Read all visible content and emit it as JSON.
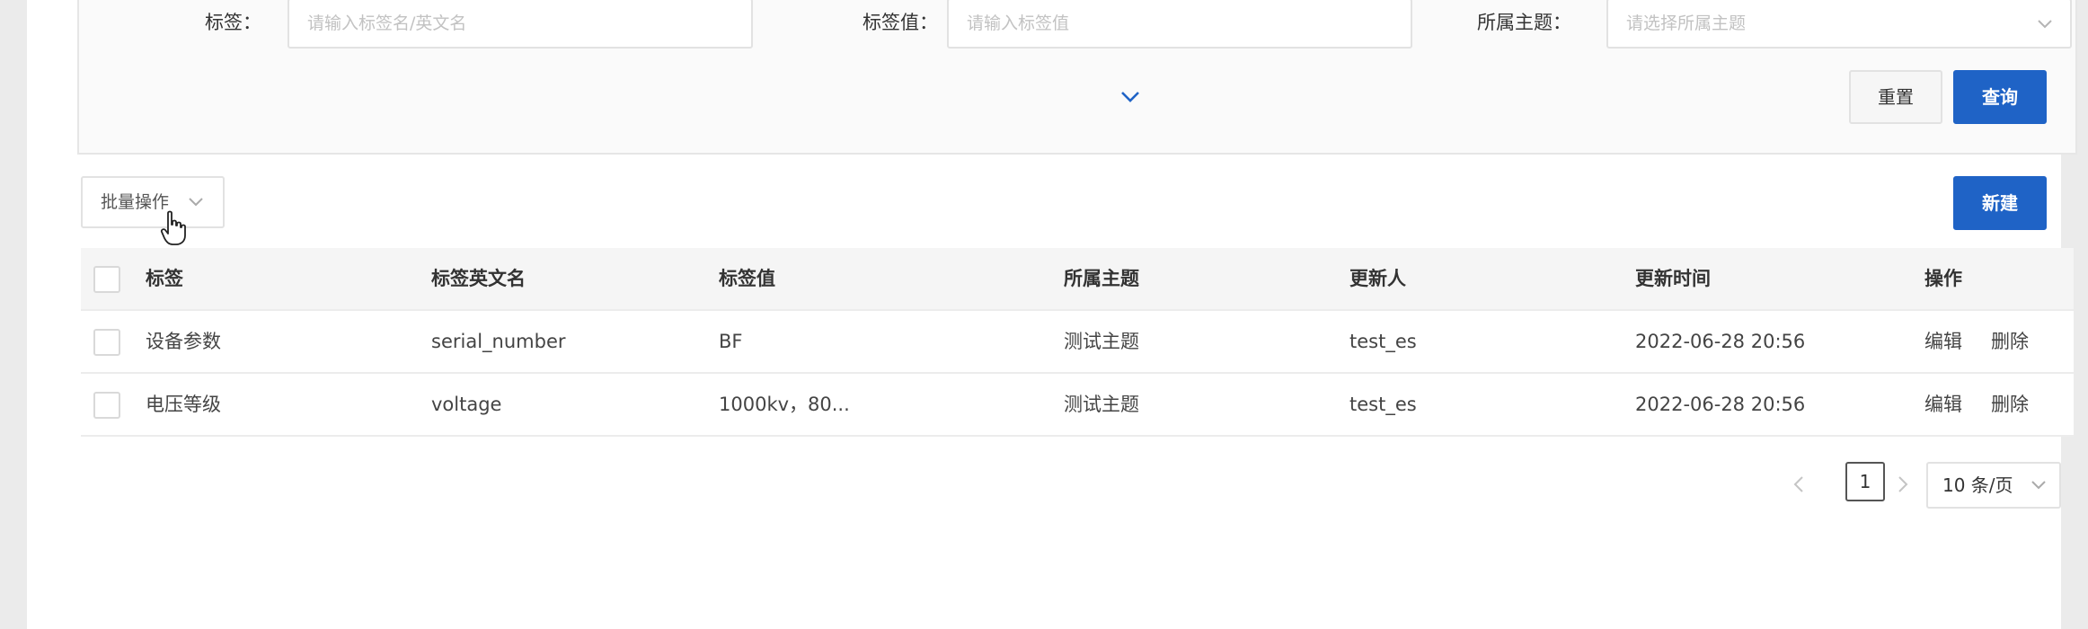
{
  "filters": {
    "tag_label": "标签：",
    "tag_placeholder": "请输入标签名/英文名",
    "tag_value_label": "标签值：",
    "tag_value_placeholder": "请输入标签值",
    "topic_label": "所属主题：",
    "topic_placeholder": "请选择所属主题",
    "expand_icon": "chevron-down-icon",
    "reset_label": "重置",
    "query_label": "查询"
  },
  "toolbar": {
    "batch_label": "批量操作",
    "new_label": "新建"
  },
  "table": {
    "columns": [
      "标签",
      "标签英文名",
      "标签值",
      "所属主题",
      "更新人",
      "更新时间",
      "操作"
    ],
    "rows": [
      {
        "tag": "设备参数",
        "english_name": "serial_number",
        "value": "BF",
        "topic": "测试主题",
        "updater": "test_es",
        "updated_at": "2022-06-28 20:56",
        "edit": "编辑",
        "delete": "删除"
      },
      {
        "tag": "电压等级",
        "english_name": "voltage",
        "value": "1000kv，80...",
        "topic": "测试主题",
        "updater": "test_es",
        "updated_at": "2022-06-28 20:56",
        "edit": "编辑",
        "delete": "删除"
      }
    ]
  },
  "pagination": {
    "current_page": "1",
    "page_size": "10 条/页"
  },
  "colors": {
    "primary": "#1f63c6",
    "danger": "#e07070"
  }
}
